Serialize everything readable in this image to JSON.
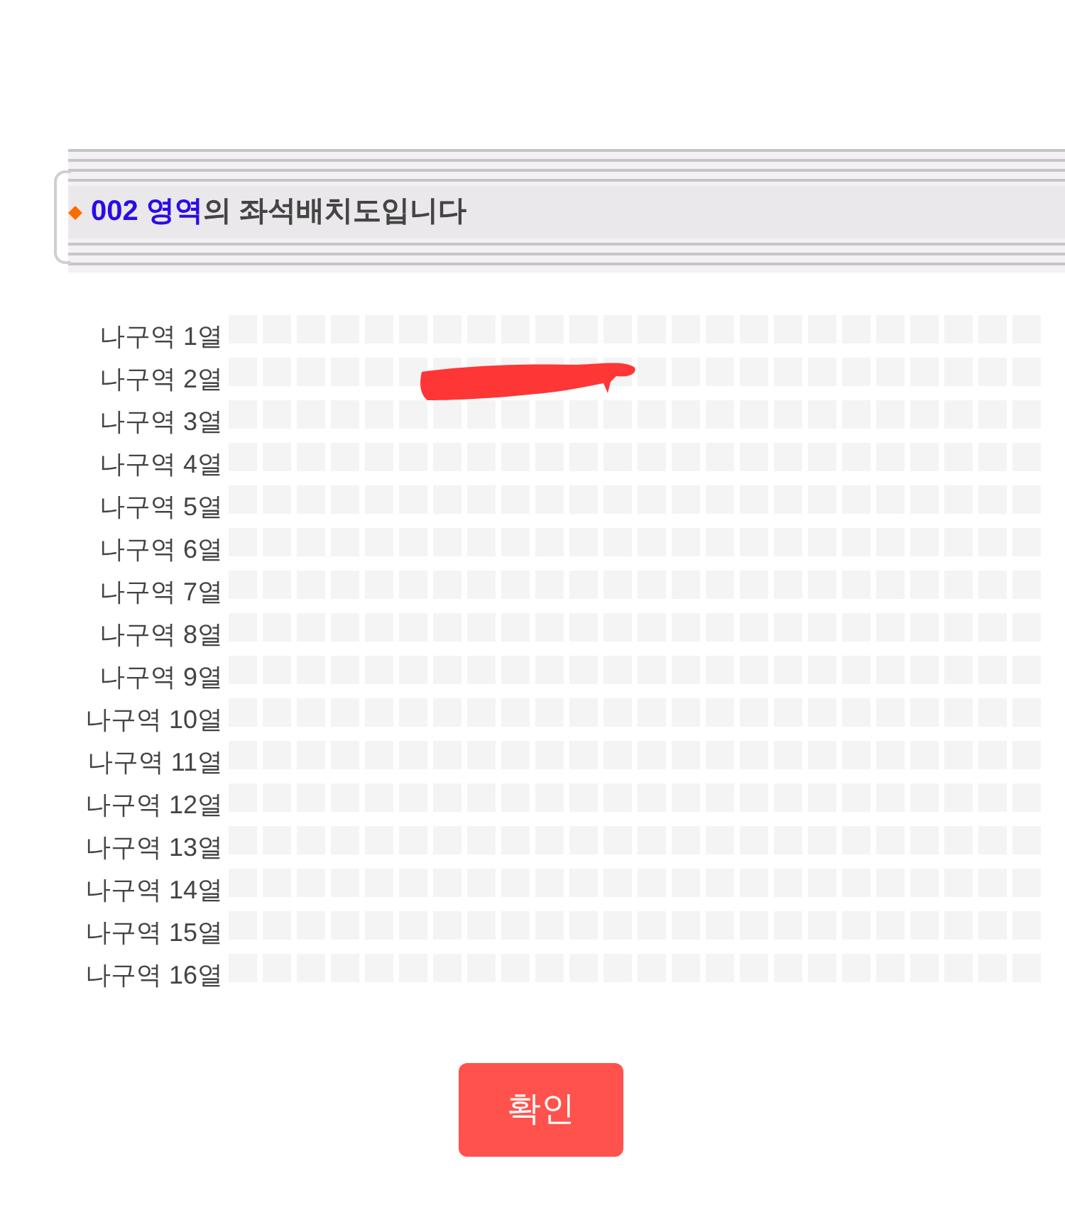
{
  "banner": {
    "highlight": "002 영역",
    "text": "의 좌석배치도입니다"
  },
  "rows": [
    {
      "label": "나구역 1열"
    },
    {
      "label": "나구역 2열"
    },
    {
      "label": "나구역 3열"
    },
    {
      "label": "나구역 4열"
    },
    {
      "label": "나구역 5열"
    },
    {
      "label": "나구역 6열"
    },
    {
      "label": "나구역 7열"
    },
    {
      "label": "나구역 8열"
    },
    {
      "label": "나구역 9열"
    },
    {
      "label": "나구역 10열"
    },
    {
      "label": "나구역 11열"
    },
    {
      "label": "나구역 12열"
    },
    {
      "label": "나구역 13열"
    },
    {
      "label": "나구역 14열"
    },
    {
      "label": "나구역 15열"
    },
    {
      "label": "나구역 16열"
    }
  ],
  "confirm_button": {
    "label": "확인"
  }
}
